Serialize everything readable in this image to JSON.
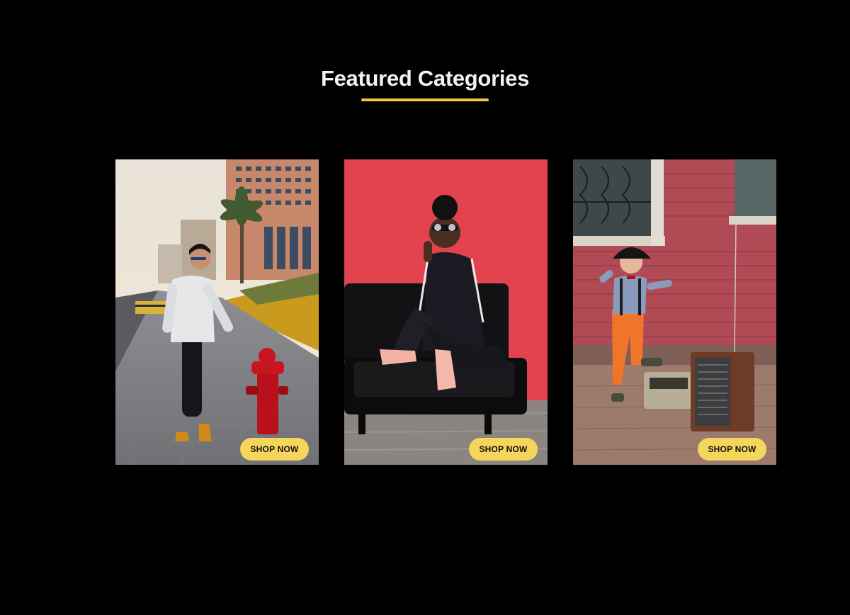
{
  "section": {
    "title": "Featured Categories",
    "accent_color": "#f6c443"
  },
  "categories": [
    {
      "image_subject": "man in white sweater leaning on red fire hydrant on city sidewalk",
      "button_label": "SHOP NOW"
    },
    {
      "image_subject": "woman in sunglasses and black tracksuit sitting on black leather sofa against red wall",
      "button_label": "SHOP NOW"
    },
    {
      "image_subject": "child in hat and orange trousers next to vintage radios by brick wall",
      "button_label": "SHOP NOW"
    }
  ],
  "button_color": "#f6d55c"
}
